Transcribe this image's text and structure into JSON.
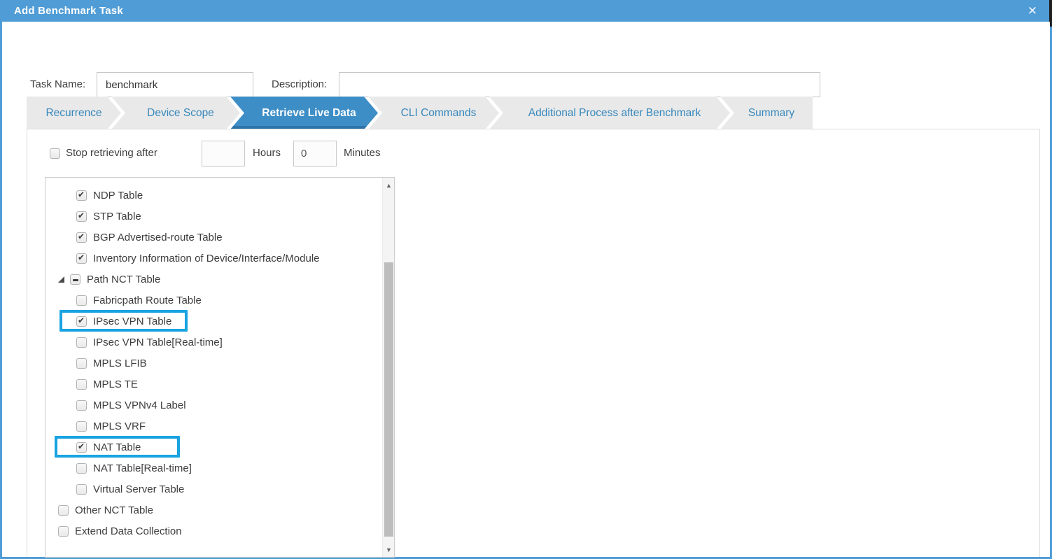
{
  "dialog": {
    "title": "Add Benchmark Task",
    "close_icon": "✕"
  },
  "form": {
    "task_name_label": "Task Name:",
    "task_name_value": "benchmark",
    "description_label": "Description:",
    "description_value": ""
  },
  "tabs": [
    {
      "label": "Recurrence",
      "active": false
    },
    {
      "label": "Device Scope",
      "active": false
    },
    {
      "label": "Retrieve Live Data",
      "active": true
    },
    {
      "label": "CLI Commands",
      "active": false
    },
    {
      "label": "Additional Process after Benchmark",
      "active": false
    },
    {
      "label": "Summary",
      "active": false
    }
  ],
  "retrieve_options": {
    "stop_label": "Stop retrieving after",
    "stop_checked": false,
    "hours_value": "",
    "hours_label": "Hours",
    "minutes_value": "0",
    "minutes_label": "Minutes"
  },
  "tree": {
    "items": [
      {
        "label": "NDP Table",
        "state": "checked",
        "level": 1,
        "expander": false,
        "highlighted": false
      },
      {
        "label": "STP Table",
        "state": "checked",
        "level": 1,
        "expander": false,
        "highlighted": false
      },
      {
        "label": "BGP Advertised-route Table",
        "state": "checked",
        "level": 1,
        "expander": false,
        "highlighted": false
      },
      {
        "label": "Inventory Information of Device/Interface/Module",
        "state": "checked",
        "level": 1,
        "expander": false,
        "highlighted": false
      },
      {
        "label": "Path NCT Table",
        "state": "indeterminate",
        "level": 0,
        "expander": true,
        "highlighted": false
      },
      {
        "label": "Fabricpath Route Table",
        "state": "unchecked",
        "level": 1,
        "expander": false,
        "highlighted": false
      },
      {
        "label": "IPsec VPN Table",
        "state": "checked",
        "level": 1,
        "expander": false,
        "highlighted": true
      },
      {
        "label": "IPsec VPN Table[Real-time]",
        "state": "unchecked",
        "level": 1,
        "expander": false,
        "highlighted": false
      },
      {
        "label": "MPLS LFIB",
        "state": "unchecked",
        "level": 1,
        "expander": false,
        "highlighted": false
      },
      {
        "label": "MPLS TE",
        "state": "unchecked",
        "level": 1,
        "expander": false,
        "highlighted": false
      },
      {
        "label": "MPLS VPNv4 Label",
        "state": "unchecked",
        "level": 1,
        "expander": false,
        "highlighted": false
      },
      {
        "label": "MPLS VRF",
        "state": "unchecked",
        "level": 1,
        "expander": false,
        "highlighted": false
      },
      {
        "label": "NAT Table",
        "state": "checked",
        "level": 1,
        "expander": false,
        "highlighted": true
      },
      {
        "label": "NAT Table[Real-time]",
        "state": "unchecked",
        "level": 1,
        "expander": false,
        "highlighted": false
      },
      {
        "label": "Virtual Server Table",
        "state": "unchecked",
        "level": 1,
        "expander": false,
        "highlighted": false
      },
      {
        "label": "Other NCT Table",
        "state": "unchecked",
        "level": 0,
        "expander": false,
        "highlighted": false
      },
      {
        "label": "Extend Data Collection",
        "state": "unchecked",
        "level": 0,
        "expander": false,
        "highlighted": false
      }
    ]
  },
  "scrollbar": {
    "up_icon": "▲",
    "down_icon": "▼"
  },
  "colors": {
    "titlebar": "#4f9cd6",
    "tab_active": "#3d8dc6",
    "tab_active_border": "#2d73a9",
    "tab_inactive_bg": "#e9e9e9",
    "tab_text": "#3787bc",
    "highlight_box": "#18a3e1"
  }
}
